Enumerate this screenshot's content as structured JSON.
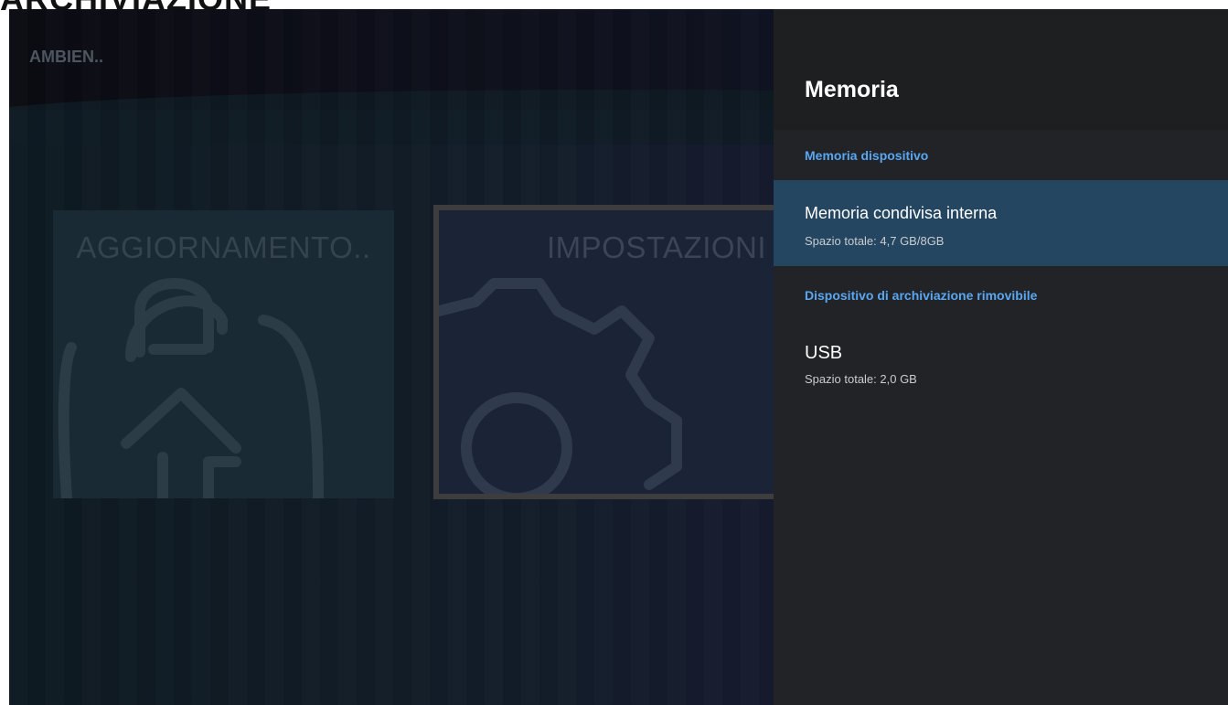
{
  "page": {
    "title": "ARCHIVIAZIONE"
  },
  "background": {
    "ambient_label": "AMBIEN..",
    "tiles": [
      {
        "label": "AGGIORNAMENTO..",
        "icon": "update-icon"
      },
      {
        "label": "IMPOSTAZIONI",
        "icon": "gear-icon"
      }
    ]
  },
  "panel": {
    "title": "Memoria",
    "sections": [
      {
        "label": "Memoria dispositivo",
        "items": [
          {
            "title": "Memoria condivisa interna",
            "subtitle": "Spazio totale: 4,7 GB/8GB",
            "selected": true
          }
        ]
      },
      {
        "label": "Dispositivo di archiviazione rimovibile",
        "items": [
          {
            "title": "USB",
            "subtitle": "Spazio totale: 2,0 GB",
            "selected": false
          }
        ]
      }
    ]
  },
  "colors": {
    "accent": "#59a7f2",
    "selected_bg": "#244660",
    "panel_bg": "#222326"
  }
}
